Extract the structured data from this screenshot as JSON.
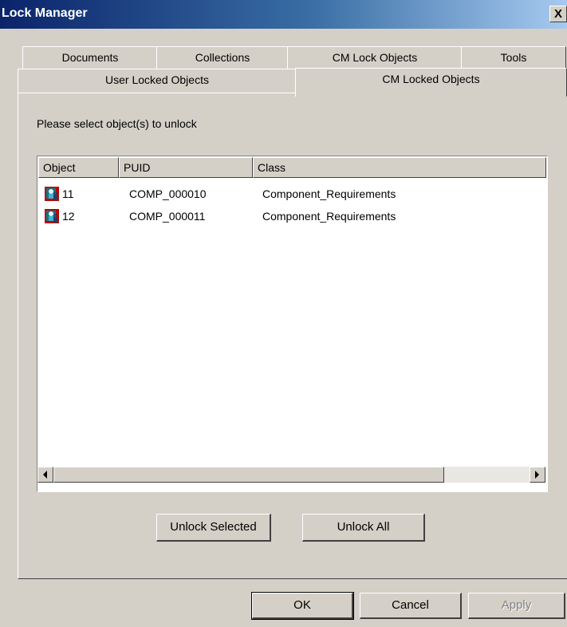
{
  "window": {
    "title": "Lock Manager",
    "close_label": "X"
  },
  "tabs": {
    "row1": [
      "Documents",
      "Collections",
      "CM Lock Objects",
      "Tools"
    ],
    "row2": [
      "User Locked Objects",
      "CM Locked Objects"
    ],
    "selected": "CM Locked Objects"
  },
  "panel": {
    "prompt": "Please select object(s) to unlock"
  },
  "list": {
    "columns": [
      "Object",
      "PUID",
      "Class"
    ],
    "rows": [
      {
        "icon": "locked-object-icon",
        "object": "11",
        "puid": "COMP_000010",
        "class": "Component_Requirements"
      },
      {
        "icon": "locked-object-icon",
        "object": "12",
        "puid": "COMP_000011",
        "class": "Component_Requirements"
      }
    ]
  },
  "actions": {
    "unlock_selected": "Unlock Selected",
    "unlock_all": "Unlock All"
  },
  "footer": {
    "ok": "OK",
    "cancel": "Cancel",
    "apply": "Apply"
  },
  "colors": {
    "face": "#d4d0c8",
    "title_start": "#0a246a",
    "title_end": "#a6caf0",
    "disabled_text": "#808080"
  }
}
